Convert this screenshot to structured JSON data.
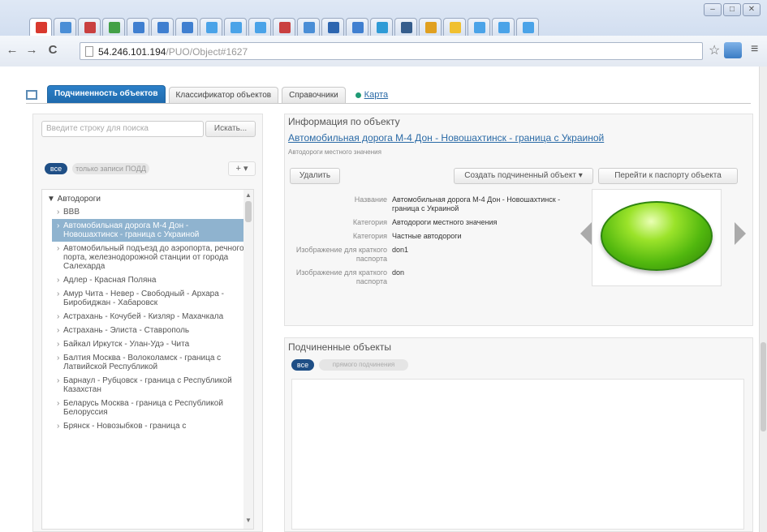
{
  "browser": {
    "url_host": "54.246.101.194",
    "url_path": "/PUO/Object#1627",
    "tab_favicon_colors": [
      "#d9392e",
      "#4a8ed6",
      "#c94040",
      "#43a047",
      "#3f7fd0",
      "#3f7fd0",
      "#3f7fd0",
      "#4aa3e8",
      "#4aa3e8",
      "#4aa3e8",
      "#c94040",
      "#4a8ed6",
      "#2d66b0",
      "#3f7fd0",
      "#2f9bd6",
      "#355d8c",
      "#e0a020",
      "#f0c030",
      "#4aa3e8",
      "#4aa3e8",
      "#4aa3e8"
    ]
  },
  "app_tabs": {
    "subordination": "Подчиненность объектов",
    "classifier": "Классификатор объектов",
    "reference": "Справочники",
    "map": "Карта"
  },
  "left": {
    "search_placeholder": "Введите строку для поиска",
    "search_button": "Искать...",
    "filter_all": "все",
    "filter_odd": "только записи ПОДД",
    "add_button": "+ ▾",
    "tree_root": "▼ Автодороги",
    "tree_items": [
      "BBB",
      "Автомобильная дорога М-4 Дон - Новошахтинск - граница с Украиной",
      "Автомобильный подъезд до аэропорта, речного порта, железнодорожной станции от города Салехарда",
      "Адлер - Красная Поляна",
      "Амур Чита - Невер - Свободный - Архара - Биробиджан - Хабаровск",
      "Астрахань - Кочубей - Кизляр - Махачкала",
      "Астрахань - Элиста - Ставрополь",
      "Байкал Иркутск - Улан-Удэ - Чита",
      "Балтия Москва - Волоколамск - граница с Латвийской Республикой",
      "Барнаул - Рубцовск - граница с Республикой Казахстан",
      "Беларусь Москва - граница с Республикой Белоруссия",
      "Брянск - Новозыбков - граница с"
    ]
  },
  "info": {
    "header": "Информация по объекту",
    "title": "Автомобильная дорога М-4 Дон - Новошахтинск - граница с Украиной",
    "subtitle": "Автодороги местного значения",
    "delete_button": "Удалить",
    "create_sub_button": "Создать подчиненный объект ▾",
    "passport_button": "Перейти к паспорту объекта",
    "properties": [
      {
        "label": "Название",
        "value": "Автомобильная дорога М-4 Дон - Новошахтинск - граница с Украиной"
      },
      {
        "label": "Категория",
        "value": "Автодороги местного значения"
      },
      {
        "label": "Категория",
        "value": "Частные автодороги"
      },
      {
        "label": "Изображение для краткого паспорта",
        "value": "don1"
      },
      {
        "label": "Изображение для краткого паспорта",
        "value": "don"
      }
    ]
  },
  "sub": {
    "header": "Подчиненные объекты",
    "filter_all": "все",
    "filter_direct": "прямого подчинения"
  }
}
